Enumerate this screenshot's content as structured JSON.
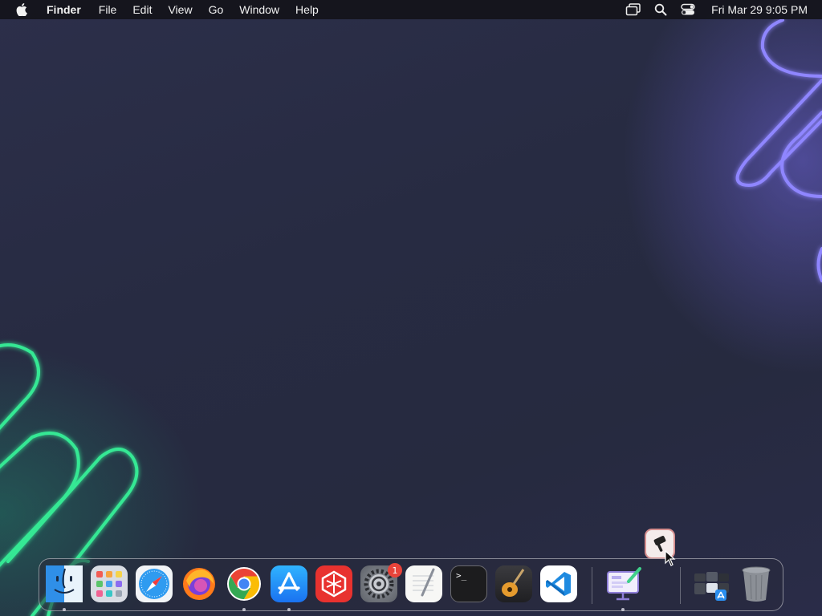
{
  "menubar": {
    "apple_icon": "apple-logo-icon",
    "app_name": "Finder",
    "items": [
      "File",
      "Edit",
      "View",
      "Go",
      "Window",
      "Help"
    ],
    "status_icons": [
      "screen-mirroring-icon",
      "spotlight-search-icon",
      "control-center-icon"
    ],
    "clock": "Fri Mar 29  9:05 PM"
  },
  "dock": {
    "apps": [
      {
        "name": "Finder",
        "icon": "finder-icon",
        "running": true
      },
      {
        "name": "Launchpad",
        "icon": "launchpad-icon",
        "running": false
      },
      {
        "name": "Safari",
        "icon": "safari-icon",
        "running": false
      },
      {
        "name": "Firefox",
        "icon": "firefox-icon",
        "running": false
      },
      {
        "name": "Google Chrome",
        "icon": "chrome-icon",
        "running": true
      },
      {
        "name": "App Store",
        "icon": "app-store-icon",
        "running": true
      },
      {
        "name": "WPS Office",
        "icon": "wps-office-icon",
        "running": false
      },
      {
        "name": "System Settings",
        "icon": "system-settings-icon",
        "running": false,
        "badge": "1"
      },
      {
        "name": "TextEdit",
        "icon": "textedit-icon",
        "running": false
      },
      {
        "name": "Terminal",
        "icon": "terminal-icon",
        "running": false
      },
      {
        "name": "GarageBand",
        "icon": "garageband-icon",
        "running": false
      },
      {
        "name": "Visual Studio Code",
        "icon": "vscode-icon",
        "running": false
      }
    ],
    "recent": [
      {
        "name": "Presentation App",
        "icon": "presentation-app-icon",
        "running": true
      }
    ],
    "stacks": [
      {
        "name": "Applications Folder",
        "icon": "applications-stack-icon"
      },
      {
        "name": "Trash",
        "icon": "trash-icon"
      }
    ],
    "terminal_prompt": ">_"
  },
  "dragging_item": {
    "icon": "hammer-app-icon"
  },
  "colors": {
    "menubar_bg": "#14141a",
    "desktop_bg": "#272b42",
    "neon_green": "#2ee08a",
    "neon_purple": "#8f86ff",
    "badge_red": "#e8433a"
  }
}
